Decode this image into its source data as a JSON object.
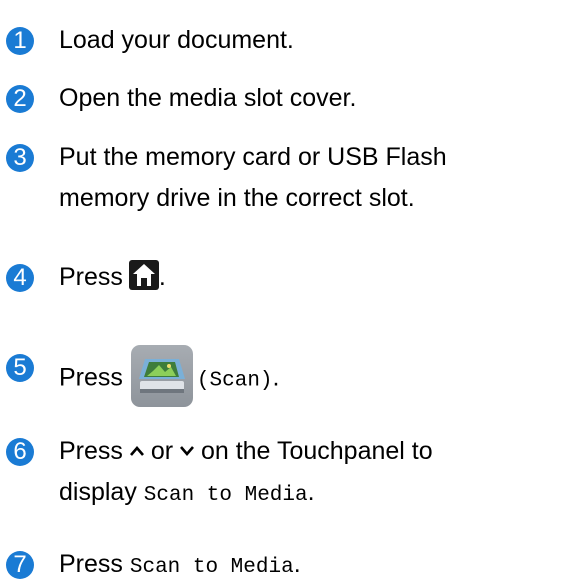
{
  "steps": [
    {
      "num": "1",
      "text": "Load your document."
    },
    {
      "num": "2",
      "text": "Open the media slot cover."
    },
    {
      "num": "3",
      "line1": "Put the memory card or USB Flash",
      "line2": "memory drive in the correct slot."
    },
    {
      "num": "4",
      "prefix": "Press",
      "suffix": ".",
      "icon": "home-icon"
    },
    {
      "num": "5",
      "prefix": "Press",
      "code": "(Scan)",
      "suffix": ".",
      "icon": "scan-icon"
    },
    {
      "num": "6",
      "prefix": "Press",
      "mid1": "or",
      "line1_end": "on the Touchpanel to",
      "line2_prefix": "display",
      "line2_code": "Scan to Media",
      "line2_suffix": ".",
      "up_icon": "chevron-up-icon",
      "down_icon": "chevron-down-icon"
    },
    {
      "num": "7",
      "prefix": "Press",
      "code": "Scan to Media",
      "suffix": "."
    }
  ],
  "colors": {
    "badge": "#1a7bd4"
  }
}
